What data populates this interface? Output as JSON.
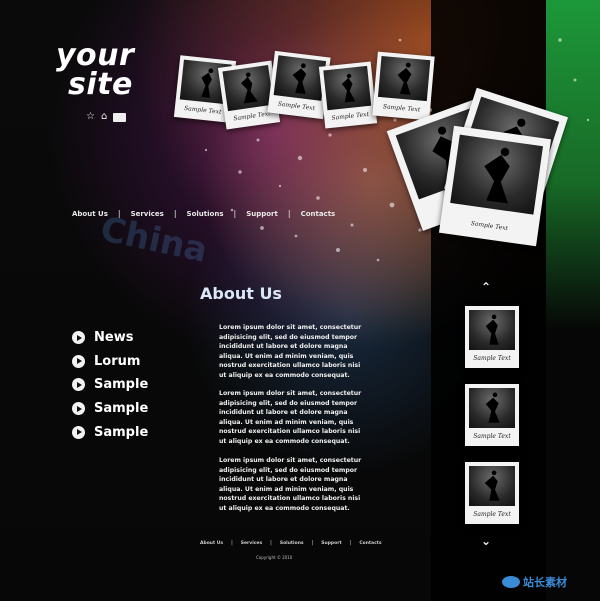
{
  "logo": {
    "line1": "your",
    "line2": "site"
  },
  "header_icons": [
    "star-icon",
    "home-icon",
    "mail-icon"
  ],
  "nav": {
    "items": [
      "About Us",
      "Services",
      "Solutions",
      "Support",
      "Contacts"
    ]
  },
  "watermark": "China",
  "about": {
    "title": "About Us",
    "paragraphs": [
      "Lorem ipsum dolor sit amet, consectetur adipisicing elit, sed do eiusmod tempor incididunt ut labore et dolore magna aliqua. Ut enim ad minim veniam, quis nostrud exercitation ullamco laboris nisi ut aliquip ex ea commodo consequat.",
      "Lorem ipsum dolor sit amet, consectetur adipisicing elit, sed do eiusmod tempor incididunt ut labore et dolore magna aliqua. Ut enim ad minim veniam, quis nostrud exercitation ullamco laboris nisi ut aliquip ex ea commodo consequat.",
      "Lorem ipsum dolor sit amet, consectetur adipisicing elit, sed do eiusmod tempor incididunt ut labore et dolore magna aliqua. Ut enim ad minim veniam, quis nostrud exercitation ullamco laboris nisi ut aliquip ex ea commodo consequat."
    ]
  },
  "side_menu": {
    "items": [
      "News",
      "Lorum",
      "Sample",
      "Sample",
      "Sample"
    ]
  },
  "photo_caption": "Sample Text",
  "gallery": {
    "up_arrow": "⌃",
    "down_arrow": "⌄"
  },
  "footer": {
    "nav": [
      "About Us",
      "Services",
      "Solutions",
      "Support",
      "Contacts"
    ],
    "copyright": "Copyright © 2010"
  },
  "corner_mark": {
    "text": "站长素材"
  }
}
